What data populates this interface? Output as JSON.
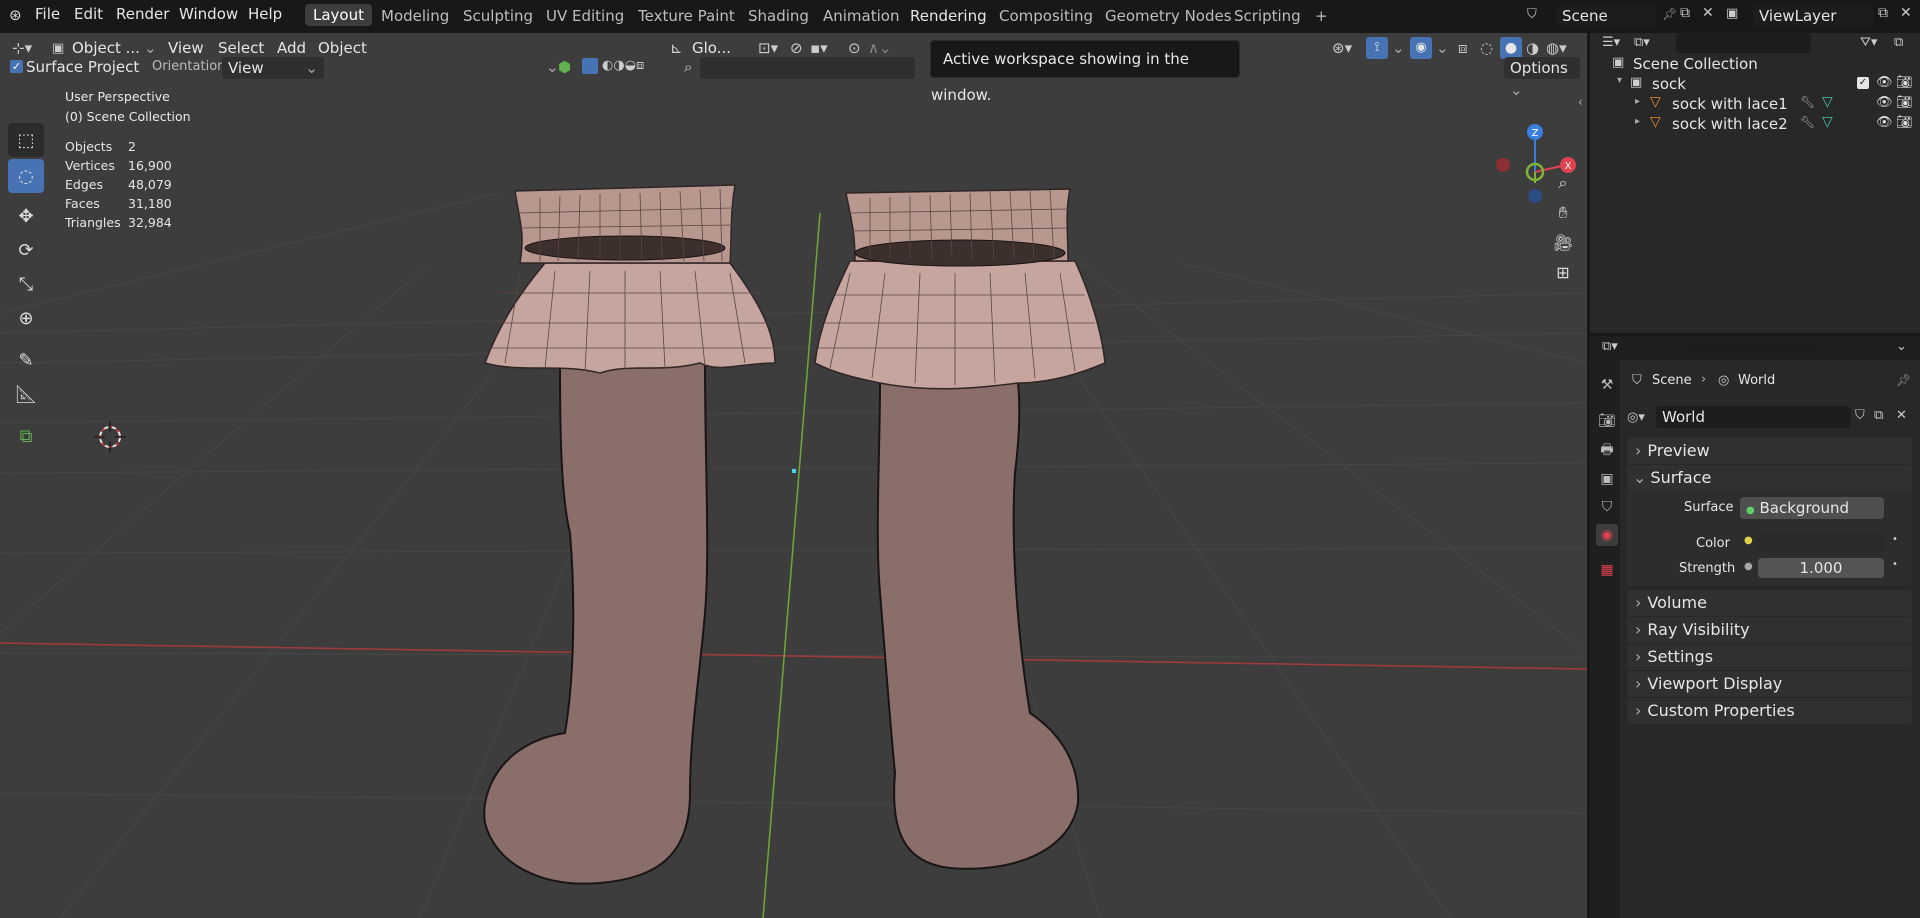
{
  "menubar": {
    "items": [
      "File",
      "Edit",
      "Render",
      "Window",
      "Help"
    ],
    "tabs": [
      "Layout",
      "Modeling",
      "Sculpting",
      "UV Editing",
      "Texture Paint",
      "Shading",
      "Animation",
      "Rendering",
      "Compositing",
      "Geometry Nodes",
      "Scripting"
    ],
    "active_tab": "Layout",
    "add_tab": "+",
    "scene": "Scene",
    "view_layer": "ViewLayer"
  },
  "viewport_header": {
    "mode": "Object ...",
    "view": "View",
    "select": "Select",
    "add": "Add",
    "object": "Object",
    "transform_orientation": "Glo...",
    "surface_project_label": "Surface Project",
    "surface_project_checked": true,
    "orientation_label": "Orientation:",
    "orientation_value": "View",
    "options": "Options"
  },
  "tooltip": "Active workspace showing in the window.",
  "overlay": {
    "view_name": "User Perspective",
    "collection": "(0) Scene Collection",
    "stats": [
      {
        "label": "Objects",
        "value": "2"
      },
      {
        "label": "Vertices",
        "value": "16,900"
      },
      {
        "label": "Edges",
        "value": "48,079"
      },
      {
        "label": "Faces",
        "value": "31,180"
      },
      {
        "label": "Triangles",
        "value": "32,984"
      }
    ]
  },
  "gizmo": {
    "x": "X",
    "y": "Y",
    "z": "Z"
  },
  "outliner": {
    "root": "Scene Collection",
    "collection": "sock",
    "objects": [
      "sock with lace1",
      "sock with lace2"
    ]
  },
  "properties": {
    "breadcrumb_scene": "Scene",
    "breadcrumb_world": "World",
    "world_name": "World",
    "panels": {
      "preview": "Preview",
      "surface": "Surface",
      "volume": "Volume",
      "ray_visibility": "Ray Visibility",
      "settings": "Settings",
      "viewport_display": "Viewport Display",
      "custom_properties": "Custom Properties"
    },
    "surface_label": "Surface",
    "surface_value": "Background",
    "color_label": "Color",
    "strength_label": "Strength",
    "strength_value": "1.000"
  },
  "colors": {
    "accent": "#4772b3",
    "viewport_bg": "#3d3d3d",
    "x_axis": "#e0424f",
    "y_axis": "#7fb33a",
    "z_axis": "#3a7ee0"
  }
}
